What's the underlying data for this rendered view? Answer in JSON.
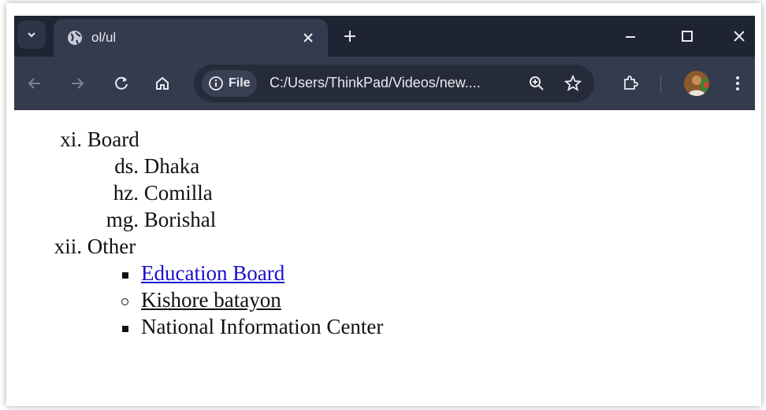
{
  "browser": {
    "tab_title": "ol/ul",
    "site_chip": "File",
    "url": "C:/Users/ThinkPad/Videos/new....",
    "colors": {
      "tabbar": "#1f2433",
      "toolbar": "#353b4e",
      "omnibox": "#262b3a"
    },
    "icons": [
      "tab-search-icon",
      "globe-icon",
      "close-icon",
      "plus-icon",
      "minimize-icon",
      "maximize-icon",
      "window-close-icon",
      "back-icon",
      "forward-icon",
      "reload-icon",
      "home-icon",
      "info-icon",
      "zoom-icon",
      "star-icon",
      "extensions-icon",
      "more-icon"
    ]
  },
  "page": {
    "lists": [
      {
        "marker": "xi.",
        "label": "Board"
      },
      {
        "marker": "ds.",
        "label": "Dhaka"
      },
      {
        "marker": "hz.",
        "label": "Comilla"
      },
      {
        "marker": "mg.",
        "label": "Borishal"
      },
      {
        "marker": "xii.",
        "label": "Other"
      }
    ],
    "other_items": [
      {
        "bullet": "square",
        "label": "Education Board",
        "link_color": "#1a0dcc"
      },
      {
        "bullet": "circle",
        "label": "Kishore batayon"
      },
      {
        "bullet": "square",
        "label": "National Information Center"
      }
    ]
  }
}
